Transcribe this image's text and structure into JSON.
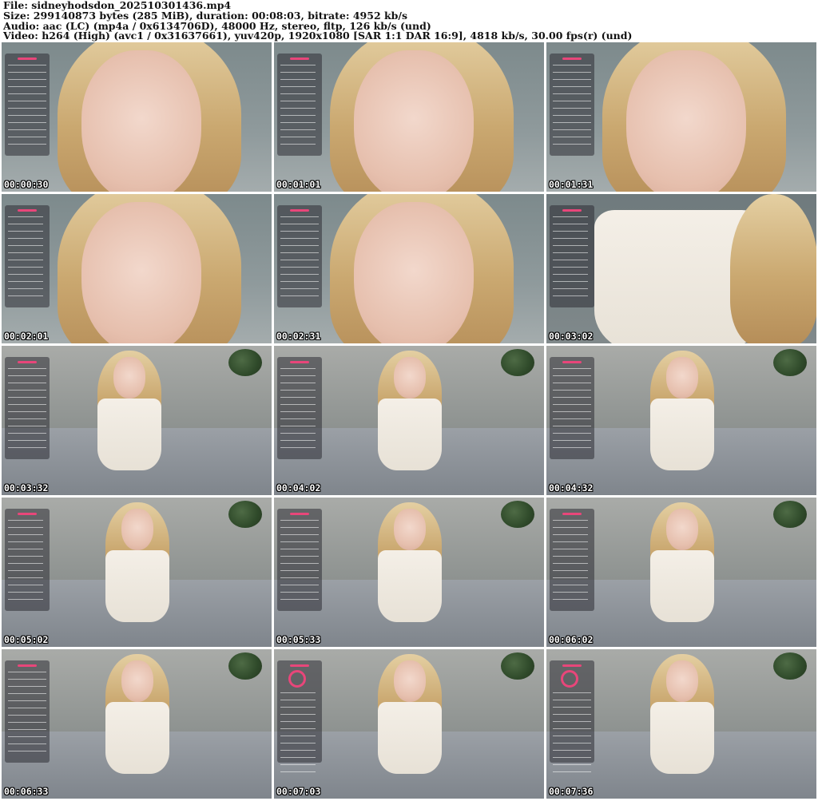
{
  "header": {
    "line1": "File: sidneyhodsdon_202510301436.mp4",
    "line2": "Size: 299140873 bytes (285 MiB), duration: 00:08:03, bitrate: 4952 kb/s",
    "line3": "Audio: aac (LC) (mp4a / 0x6134706D), 48000 Hz, stereo, fltp, 126 kb/s (und)",
    "line4": "Video: h264 (High) (avc1 / 0x31637661), yuv420p, 1920x1080 [SAR 1:1 DAR 16:9], 4818 kb/s, 30.00 fps(r) (und)"
  },
  "thumbnails": [
    {
      "timestamp": "00:00:30",
      "scene": "closeup"
    },
    {
      "timestamp": "00:01:01",
      "scene": "closeup"
    },
    {
      "timestamp": "00:01:31",
      "scene": "closeup"
    },
    {
      "timestamp": "00:02:01",
      "scene": "closeup"
    },
    {
      "timestamp": "00:02:31",
      "scene": "closeup"
    },
    {
      "timestamp": "00:03:02",
      "scene": "dress-closeup"
    },
    {
      "timestamp": "00:03:32",
      "scene": "room"
    },
    {
      "timestamp": "00:04:02",
      "scene": "bed"
    },
    {
      "timestamp": "00:04:32",
      "scene": "bed"
    },
    {
      "timestamp": "00:05:02",
      "scene": "bed"
    },
    {
      "timestamp": "00:05:33",
      "scene": "bed"
    },
    {
      "timestamp": "00:06:02",
      "scene": "bed"
    },
    {
      "timestamp": "00:06:33",
      "scene": "bed"
    },
    {
      "timestamp": "00:07:03",
      "scene": "bed"
    },
    {
      "timestamp": "00:07:36",
      "scene": "bed"
    }
  ],
  "colors": {
    "overlay_accent": "#e8467a",
    "timestamp_text": "#ffffff"
  }
}
